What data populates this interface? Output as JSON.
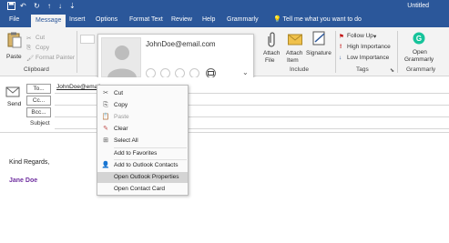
{
  "window": {
    "doc_title": "Untitled",
    "qat": [
      "save-icon",
      "undo-icon",
      "redo-icon",
      "up-icon",
      "down-icon",
      "more-icon"
    ]
  },
  "ribbon": {
    "tabs": [
      {
        "label": "File"
      },
      {
        "label": "Message",
        "active": true
      },
      {
        "label": "Insert"
      },
      {
        "label": "Options"
      },
      {
        "label": "Format Text"
      },
      {
        "label": "Review"
      },
      {
        "label": "Help"
      },
      {
        "label": "Grammarly"
      }
    ],
    "tell_me": "Tell me what you want to do",
    "clipboard": {
      "paste": "Paste",
      "cut": "Cut",
      "copy": "Copy",
      "format_painter": "Format Painter",
      "group_label": "Clipboard"
    },
    "include": {
      "attach_file": "Attach",
      "attach_file_sub": "File",
      "attach_item": "Attach",
      "attach_item_sub": "Item",
      "signature": "Signature",
      "group_label": "Include"
    },
    "tags": {
      "follow_up": "Follow Up",
      "high_importance": "High Importance",
      "low_importance": "Low Importance",
      "group_label": "Tags"
    },
    "grammarly": {
      "open": "Open",
      "open_sub": "Grammarly",
      "group_label": "Grammarly"
    }
  },
  "contact_card": {
    "email": "JohnDoe@email.com"
  },
  "compose": {
    "send": "Send",
    "to_button": "To...",
    "cc_button": "Cc...",
    "bcc_button": "Bcc...",
    "subject_label": "Subject",
    "to_value": "JohnDoe@email.com",
    "signature_line1": "Kind Regards,",
    "signature_line2": "Jane Doe"
  },
  "context_menu": {
    "items": [
      {
        "label": "Cut",
        "icon": "scissors-icon"
      },
      {
        "label": "Copy",
        "icon": "copy-icon"
      },
      {
        "label": "Paste",
        "icon": "paste-icon",
        "disabled": true
      },
      {
        "label": "Clear",
        "icon": "clear-icon"
      },
      {
        "label": "Select All",
        "icon": "select-all-icon"
      },
      {
        "label": "Add to Favorites"
      },
      {
        "label": "Add to Outlook Contacts",
        "icon": "contact-add-icon"
      },
      {
        "label": "Open Outlook Properties",
        "highlighted": true
      },
      {
        "label": "Open Contact Card"
      }
    ]
  },
  "colors": {
    "accent": "#2b579a",
    "signature_name": "#7030a0",
    "menu_highlight": "#d4d4d4"
  }
}
